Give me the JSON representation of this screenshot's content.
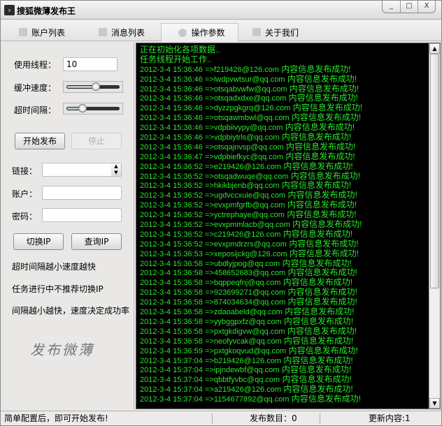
{
  "window": {
    "title": "搜狐微薄发布王",
    "minimize": "_",
    "maximize": "□",
    "close": "X"
  },
  "tabs": [
    {
      "label": "账户列表",
      "icon": "user-icon"
    },
    {
      "label": "消息列表",
      "icon": "message-icon"
    },
    {
      "label": "操作参数",
      "icon": "settings-icon",
      "active": true
    },
    {
      "label": "关于我们",
      "icon": "about-icon"
    }
  ],
  "settings": {
    "threads_label": "使用线程：",
    "threads_value": "10",
    "buffer_label": "缓冲速度：",
    "buffer_value": 0.55,
    "timeout_label": "超时间隔：",
    "timeout_value": 0.3,
    "start_button": "开始发布",
    "stop_button": "停止",
    "link_label": "链接：",
    "link_value": "",
    "account_label": "账户：",
    "account_value": "",
    "password_label": "密码：",
    "password_value": "",
    "switch_ip_button": "切换IP",
    "query_ip_button": "查询IP",
    "tips": [
      "超时间隔越小速度越快",
      "任务进行中不推荐切换IP",
      "间隔越小越快，速度决定成功率"
    ],
    "logo_text": "发布微薄"
  },
  "log": {
    "intro": [
      "正在初始化各项数据..",
      "任务线程开始工作.."
    ],
    "suffix": " 内容信息发布成功!",
    "entries": [
      [
        "2012-3-4 15:36:46",
        "f219426@126.com"
      ],
      [
        "2012-3-4 15:36:46",
        "lwdpvwtsur@qq.com"
      ],
      [
        "2012-3-4 15:36:46",
        "otsqabvwfw@qq.com"
      ],
      [
        "2012-3-4 15:36:46",
        "otsqadxdxe@qq.com"
      ],
      [
        "2012-3-4 15:36:46",
        "dyzzpgkgrq@126.com"
      ],
      [
        "2012-3-4 15:36:46",
        "otsqawmbwl@qq.com"
      ],
      [
        "2012-3-4 15:36:46",
        "vdpbiivypy@qq.com"
      ],
      [
        "2012-3-4 15:36:46",
        "vdpbiytrls@qq.com"
      ],
      [
        "2012-3-4 15:36:46",
        "otsqajnvsp@qq.com"
      ],
      [
        "2012-3-4 15:36:47",
        "vdpbiefkyc@qq.com"
      ],
      [
        "2012-3-4 15:36:52",
        "e219426@126.com"
      ],
      [
        "2012-3-4 15:36:52",
        "otsqadwuqe@qq.com"
      ],
      [
        "2012-3-4 15:36:52",
        "hkikbjenb@qq.com"
      ],
      [
        "2012-3-4 15:36:52",
        "ugdvccxuie@qq.com"
      ],
      [
        "2012-3-4 15:36:52",
        "evxpmfgrfb@qq.com"
      ],
      [
        "2012-3-4 15:36:52",
        "yctrephaye@qq.com"
      ],
      [
        "2012-3-4 15:36:52",
        "evxpmmlacb@qq.com"
      ],
      [
        "2012-3-4 15:36:52",
        "c219426@126.com"
      ],
      [
        "2012-3-4 15:36:52",
        "evxpmdrzrs@qq.com"
      ],
      [
        "2012-3-4 15:36:53",
        "xeposijckg@126.com"
      ],
      [
        "2012-3-4 15:36:58",
        "ubdlyjpog@qq.com"
      ],
      [
        "2012-3-4 15:36:58",
        "458652683@qq.com"
      ],
      [
        "2012-3-4 15:36:58",
        "bqppeqfnj@qq.com"
      ],
      [
        "2012-3-4 15:36:58",
        "923699271@qq.com"
      ],
      [
        "2012-3-4 15:36:58",
        "874034634@qq.com"
      ],
      [
        "2012-3-4 15:36:58",
        "zdaoabeld@qq.com"
      ],
      [
        "2012-3-4 15:36:58",
        "yybggpxfz@qq.com"
      ],
      [
        "2012-3-4 15:36:58",
        "pxtgkdigvw@qq.com"
      ],
      [
        "2012-3-4 15:36:58",
        "neofyvcak@qq.com"
      ],
      [
        "2012-3-4 15:36:59",
        "pxtgkoqvud@qq.com"
      ],
      [
        "2012-3-4 15:37:04",
        "b219426@126.com"
      ],
      [
        "2012-3-4 15:37:04",
        "ipjndewbf@qq.com"
      ],
      [
        "2012-3-4 15:37:04",
        "qbbtfyvbc@qq.com"
      ],
      [
        "2012-3-4 15:37:04",
        "a219426@126.com"
      ],
      [
        "2012-3-4 15:37:04",
        "1154677892@qq.com"
      ]
    ]
  },
  "status": {
    "message": "简单配置后，即可开始发布!",
    "count": "发布数目：0",
    "update": "更新内容:1"
  }
}
